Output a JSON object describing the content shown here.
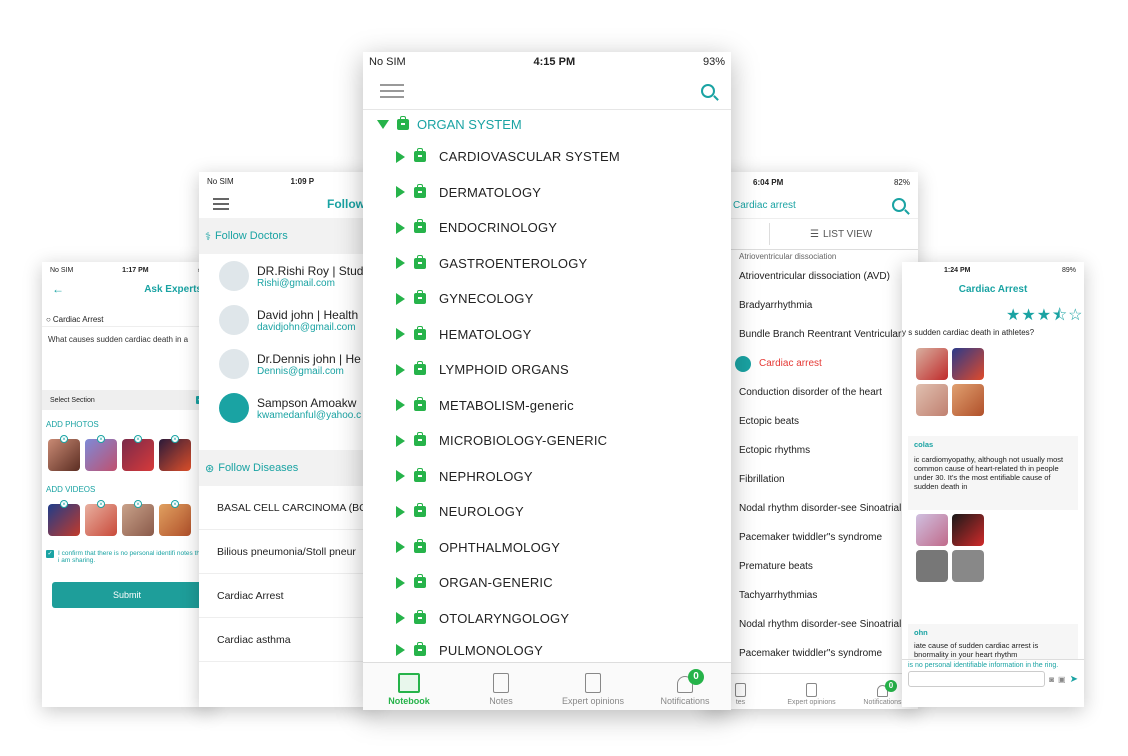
{
  "ask_experts": {
    "status": {
      "carrier": "No SIM",
      "time": "1:17 PM"
    },
    "title": "Ask Experts",
    "search_value": "Cardiac Arrest",
    "question": "What causes sudden cardiac death in a",
    "select_section": "Select Section",
    "add_photos": "ADD PHOTOS",
    "add_videos": "ADD VIDEOS",
    "confirm_text": "I confirm that there is no personal identifi notes that i am sharing.",
    "submit": "Submit"
  },
  "follow": {
    "status": {
      "carrier": "No SIM",
      "time": "1:09 P"
    },
    "title": "Follow",
    "follow_doctors": "Follow Doctors",
    "doctors": [
      {
        "name": "DR.Rishi Roy | Stud",
        "email": "Rishi@gmail.com"
      },
      {
        "name": "David john | Health",
        "email": "davidjohn@gmail.com"
      },
      {
        "name": "Dr.Dennis john | He",
        "email": "Dennis@gmail.com"
      },
      {
        "name": "Sampson Amoakw",
        "email": "kwamedanful@yahoo.c"
      }
    ],
    "follow_diseases": "Follow Diseases",
    "diseases": [
      "BASAL CELL CARCINOMA (BC",
      "Bilious pneumonia/Stoll pneur",
      "Cardiac Arrest",
      "Cardiac asthma"
    ]
  },
  "notebook": {
    "status": {
      "carrier": "No SIM",
      "time": "4:15 PM",
      "battery": "93%"
    },
    "root": "ORGAN SYSTEM",
    "items": [
      "CARDIOVASCULAR SYSTEM",
      "DERMATOLOGY",
      "ENDOCRINOLOGY",
      "GASTROENTEROLOGY",
      "GYNECOLOGY",
      "HEMATOLOGY",
      "LYMPHOID ORGANS",
      "METABOLISM-generic",
      "MICROBIOLOGY-GENERIC",
      "NEPHROLOGY",
      "NEUROLOGY",
      "OPHTHALMOLOGY",
      "ORGAN-GENERIC",
      "OTOLARYNGOLOGY",
      "PULMONOLOGY"
    ],
    "tabs": [
      "Notebook",
      "Notes",
      "Expert opinions",
      "Notifications"
    ],
    "notif_count": "0"
  },
  "cardiac_list": {
    "status": {
      "time": "6:04 PM",
      "battery": "82%"
    },
    "title": "Cardiac arrest",
    "list_view": "LIST VIEW",
    "partial_top": "Atrioventricular dissociation",
    "rows": [
      "Atrioventricular dissociation (AVD)",
      "Bradyarrhythmia",
      "Bundle Branch Reentrant Ventricular Tac",
      "Cardiac arrest",
      "Conduction disorder of the heart",
      "Ectopic beats",
      "Ectopic rhythms",
      "Fibrillation",
      "Nodal rhythm disorder-see Sinoatrial No",
      "Pacemaker twiddler\"s syndrome",
      "Premature beats",
      "Tachyarrhythmias",
      "Nodal rhythm disorder-see Sinoatrial No",
      "Pacemaker twiddler\"s syndrome"
    ],
    "tabs": [
      "tes",
      "Expert opinions",
      "Notifications"
    ],
    "notif_count": "0"
  },
  "cardiac_detail": {
    "status": {
      "time": "1:24 PM",
      "battery": "89%"
    },
    "title": "Cardiac Arrest",
    "stars": "★★★⯪☆",
    "question": "y   s sudden cardiac death in athletes?",
    "reply1_name": "colas",
    "reply1_text": "ic cardiomyopathy, although not usually most common cause of heart-related th in people under 30. It's the most entifiable cause of sudden death in",
    "reply2_name": "ohn",
    "reply2_text": "iate cause of sudden cardiac arrest is bnormality in your heart rhythm",
    "footer_text": "is no personal identifiable information in the ring."
  }
}
